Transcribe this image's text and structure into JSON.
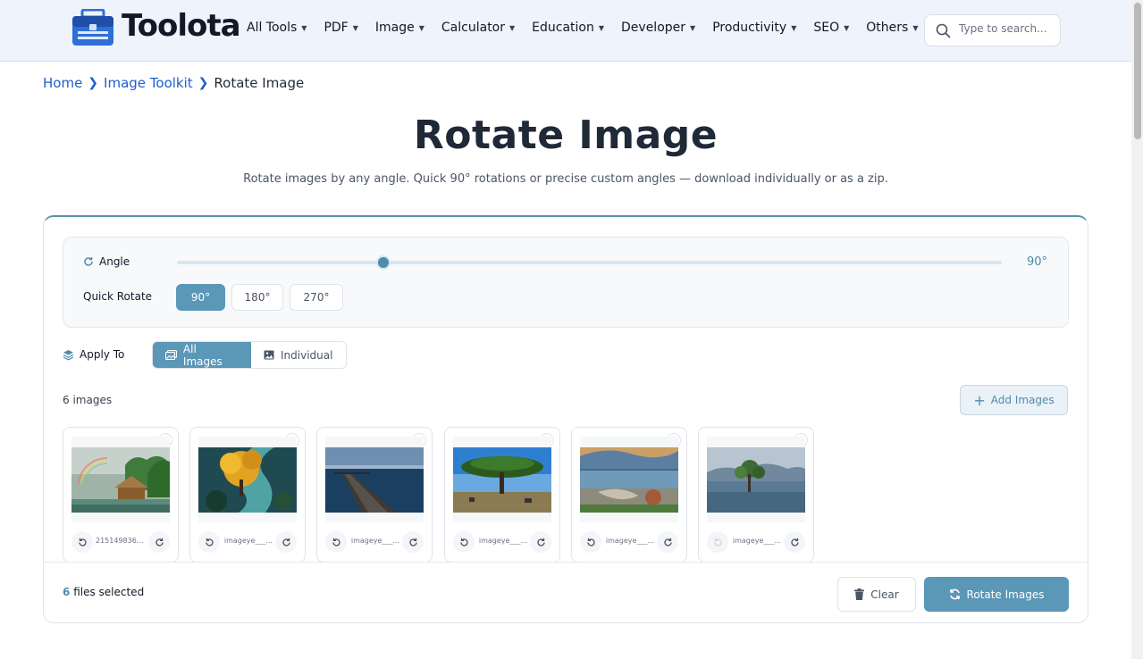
{
  "brand": {
    "name": "Toolota"
  },
  "nav": {
    "items": [
      {
        "label": "All Tools"
      },
      {
        "label": "PDF"
      },
      {
        "label": "Image"
      },
      {
        "label": "Calculator"
      },
      {
        "label": "Education"
      },
      {
        "label": "Developer"
      },
      {
        "label": "Productivity"
      },
      {
        "label": "SEO"
      },
      {
        "label": "Others"
      }
    ],
    "search_placeholder": "Type to search..."
  },
  "breadcrumb": {
    "home": "Home",
    "section": "Image Toolkit",
    "current": "Rotate Image"
  },
  "page": {
    "title": "Rotate Image",
    "subtitle": "Rotate images by any angle. Quick 90° rotations or precise custom angles — download individually or as a zip."
  },
  "settings": {
    "angle_label": "Angle",
    "angle_display": "90°",
    "angle_degrees": 90,
    "angle_max_degrees": 360,
    "quick_rotate_label": "Quick Rotate",
    "quick_options": [
      "90°",
      "180°",
      "270°"
    ],
    "quick_selected": "90°",
    "apply_label": "Apply To",
    "apply_options": [
      "All Images",
      "Individual"
    ],
    "apply_selected": "All Images"
  },
  "images": {
    "count_label": "6 images",
    "add_label": "Add Images",
    "items": [
      {
        "name": "2151498363...",
        "scene": "rainforest-hut-rainbow"
      },
      {
        "name": "imageye___...",
        "scene": "golden-tree-river"
      },
      {
        "name": "imageye___...",
        "scene": "wooden-pier-lake"
      },
      {
        "name": "imageye___...",
        "scene": "acacia-savanna"
      },
      {
        "name": "imageye___...",
        "scene": "beached-boat-sunset"
      },
      {
        "name": "imageye___...",
        "scene": "lone-tree-lake"
      }
    ]
  },
  "footer": {
    "files_count": "6",
    "files_label": "files selected",
    "clear_label": "Clear",
    "rotate_label": "Rotate Images"
  },
  "colors": {
    "accent": "#5b97b7",
    "link": "#1d5fd1",
    "header_bg": "#eef3fc"
  }
}
